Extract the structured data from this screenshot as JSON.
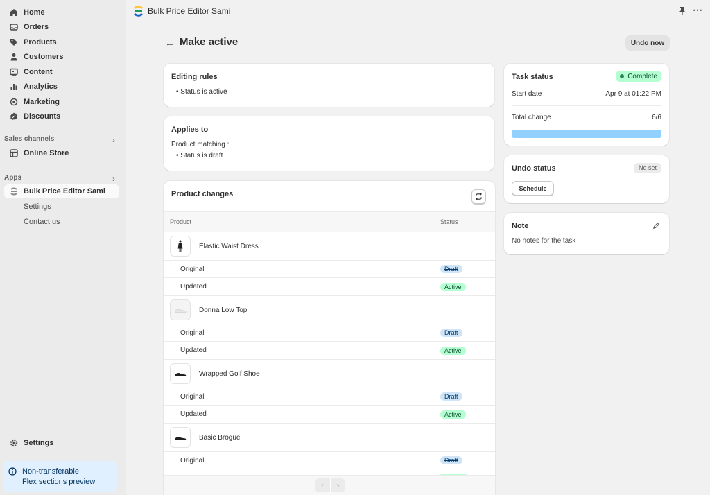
{
  "sidebar": {
    "items": [
      {
        "label": "Home",
        "icon": "home-icon"
      },
      {
        "label": "Orders",
        "icon": "inbox-icon"
      },
      {
        "label": "Products",
        "icon": "tag-icon"
      },
      {
        "label": "Customers",
        "icon": "person-icon"
      },
      {
        "label": "Content",
        "icon": "content-icon"
      },
      {
        "label": "Analytics",
        "icon": "bar-chart-icon"
      },
      {
        "label": "Marketing",
        "icon": "target-icon"
      },
      {
        "label": "Discounts",
        "icon": "discount-icon"
      }
    ],
    "sales_channels_label": "Sales channels",
    "online_store_label": "Online Store",
    "apps_label": "Apps",
    "app_name": "Bulk Price Editor Sami",
    "app_sub": [
      "Settings",
      "Contact us"
    ],
    "settings_label": "Settings",
    "banner": {
      "line1": "Non-transferable",
      "link": "Flex sections",
      "line2_rest": " preview"
    }
  },
  "topbar": {
    "app_title": "Bulk Price Editor Sami"
  },
  "page": {
    "title": "Make active",
    "undo_now_label": "Undo now"
  },
  "editing_rules": {
    "title": "Editing rules",
    "rule": "Status is active"
  },
  "applies_to": {
    "title": "Applies to",
    "matching_label": "Product matching :",
    "condition": "Status is draft"
  },
  "product_changes": {
    "title": "Product changes",
    "col_product": "Product",
    "col_status": "Status",
    "original_label": "Original",
    "updated_label": "Updated",
    "draft_label": "Draft",
    "active_label": "Active",
    "products": [
      {
        "name": "Elastic Waist Dress"
      },
      {
        "name": "Donna Low Top"
      },
      {
        "name": "Wrapped Golf Shoe"
      },
      {
        "name": "Basic Brogue"
      }
    ]
  },
  "task_status": {
    "title": "Task status",
    "badge": "Complete",
    "start_label": "Start date",
    "start_value": "Apr 9 at 01:22 PM",
    "total_label": "Total change",
    "total_value": "6/6",
    "progress": 1.0
  },
  "undo_status": {
    "title": "Undo status",
    "badge": "No set",
    "schedule_label": "Schedule"
  },
  "note": {
    "title": "Note",
    "text": "No notes for the task"
  },
  "colors": {
    "progress": "#91d0ff",
    "complete_bg": "#b4fed2",
    "active_app_bg": "#fafafa"
  }
}
